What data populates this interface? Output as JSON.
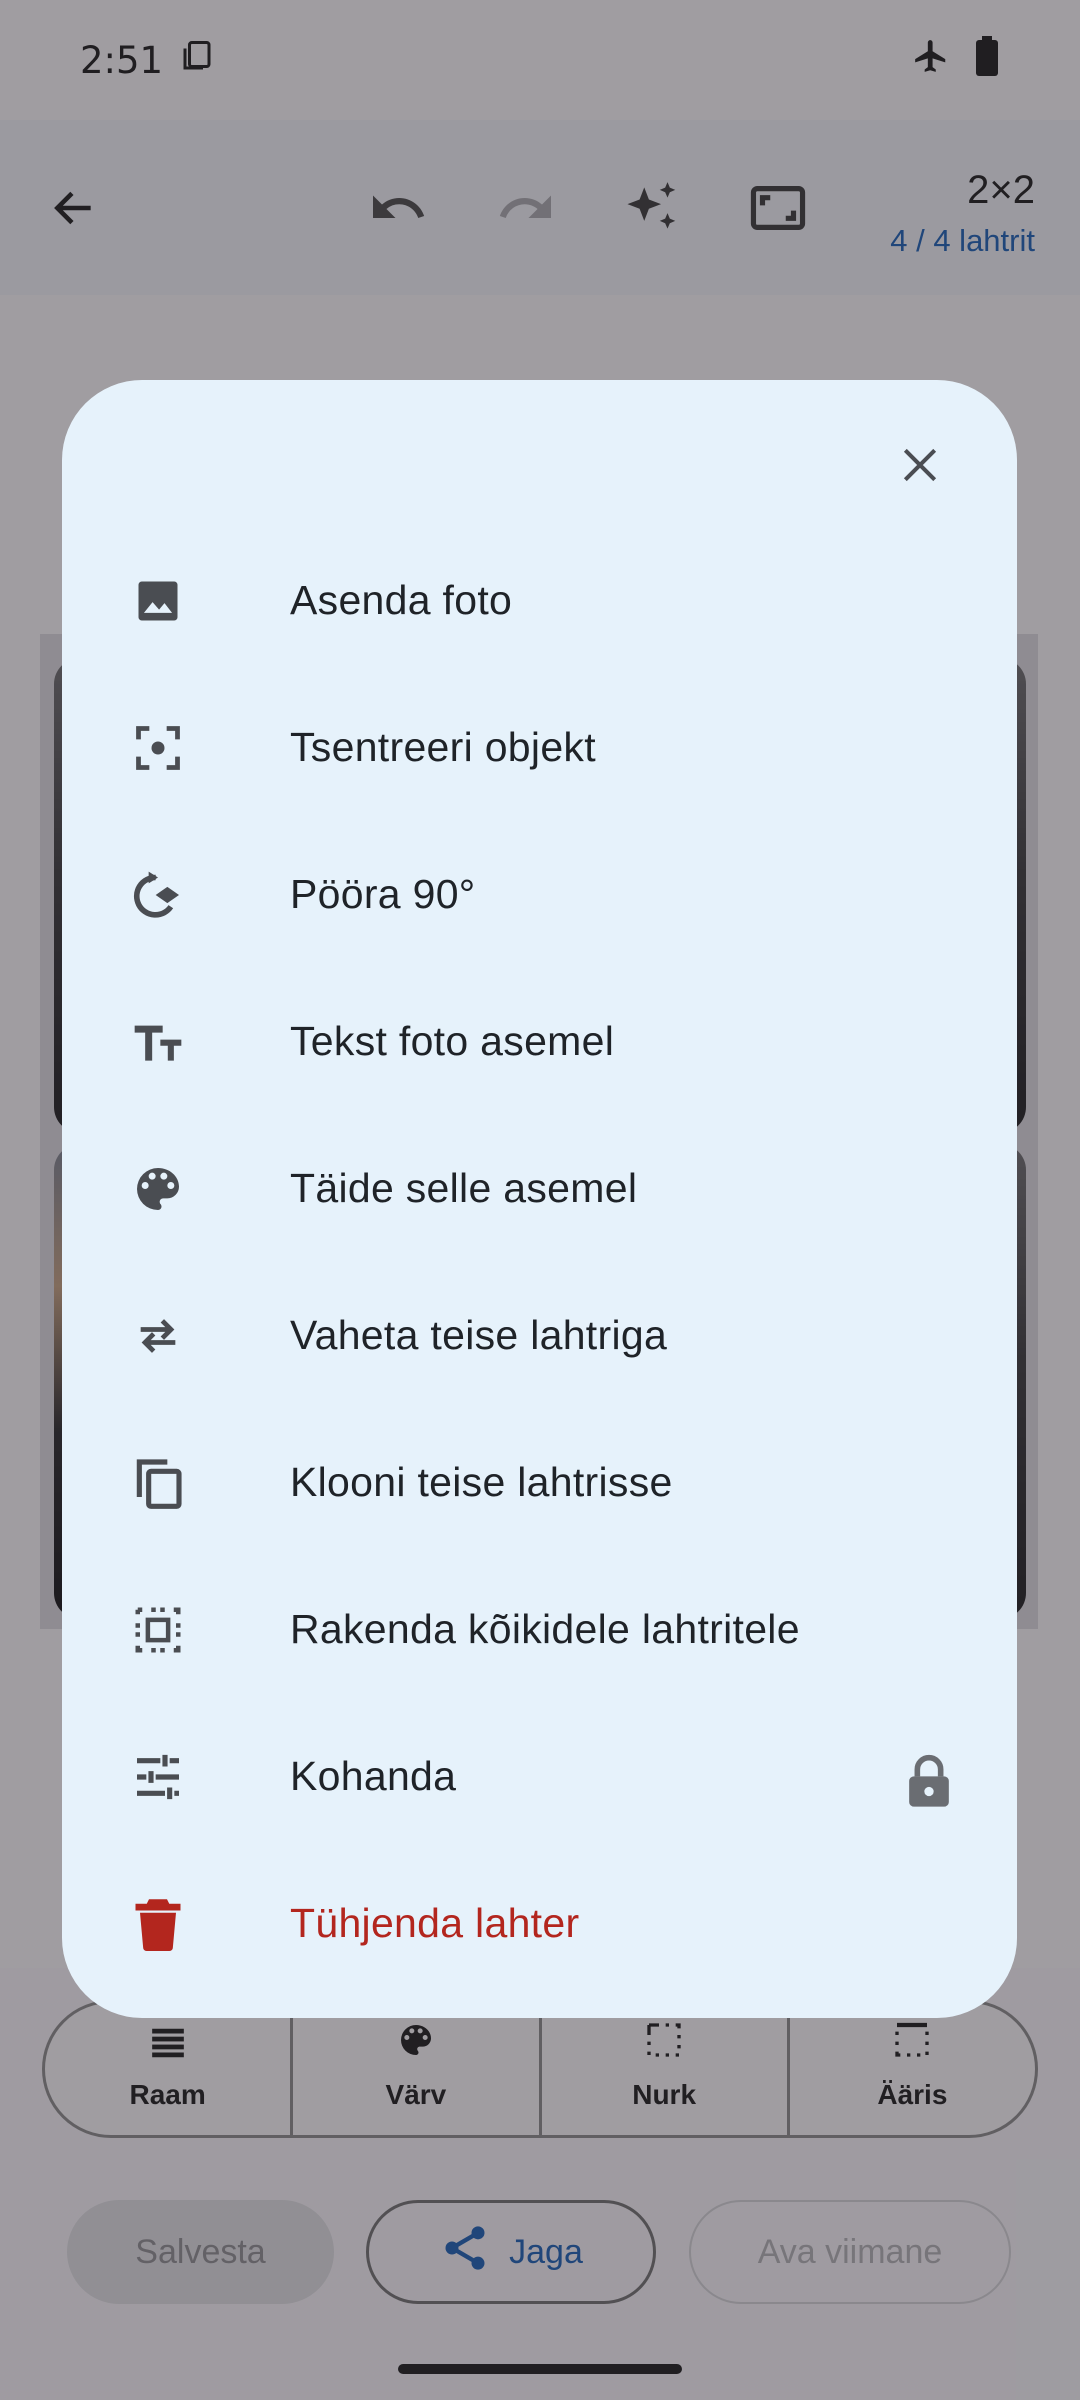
{
  "status_bar": {
    "time": "2:51"
  },
  "toolbar": {
    "grid_size": "2×2",
    "cell_count": "4 / 4 lahtrit"
  },
  "segments": [
    {
      "label": "Raam",
      "icon": "grid-lines-icon"
    },
    {
      "label": "Värv",
      "icon": "palette-icon"
    },
    {
      "label": "Nurk",
      "icon": "corner-icon"
    },
    {
      "label": "Ääris",
      "icon": "border-icon"
    }
  ],
  "actions": {
    "save": "Salvesta",
    "share": "Jaga",
    "open_last": "Ava viimane"
  },
  "dialog": {
    "items": [
      {
        "label": "Asenda foto",
        "icon": "image-icon"
      },
      {
        "label": "Tsentreeri objekt",
        "icon": "center-focus-icon"
      },
      {
        "label": "Pööra 90°",
        "icon": "rotate-icon"
      },
      {
        "label": "Tekst foto asemel",
        "icon": "text-fields-icon"
      },
      {
        "label": "Täide selle asemel",
        "icon": "palette-icon"
      },
      {
        "label": "Vaheta teise lahtriga",
        "icon": "swap-icon"
      },
      {
        "label": "Klooni teise lahtrisse",
        "icon": "copy-icon"
      },
      {
        "label": "Rakenda kõikidele lahtritele",
        "icon": "select-all-icon"
      },
      {
        "label": "Kohanda",
        "icon": "tune-icon",
        "locked": true
      },
      {
        "label": "Tühjenda lahter",
        "icon": "delete-icon",
        "danger": true
      }
    ]
  },
  "colors": {
    "accent": "#1a5fb4",
    "danger": "#b3261e",
    "dialog_bg": "#e6f2fb"
  }
}
